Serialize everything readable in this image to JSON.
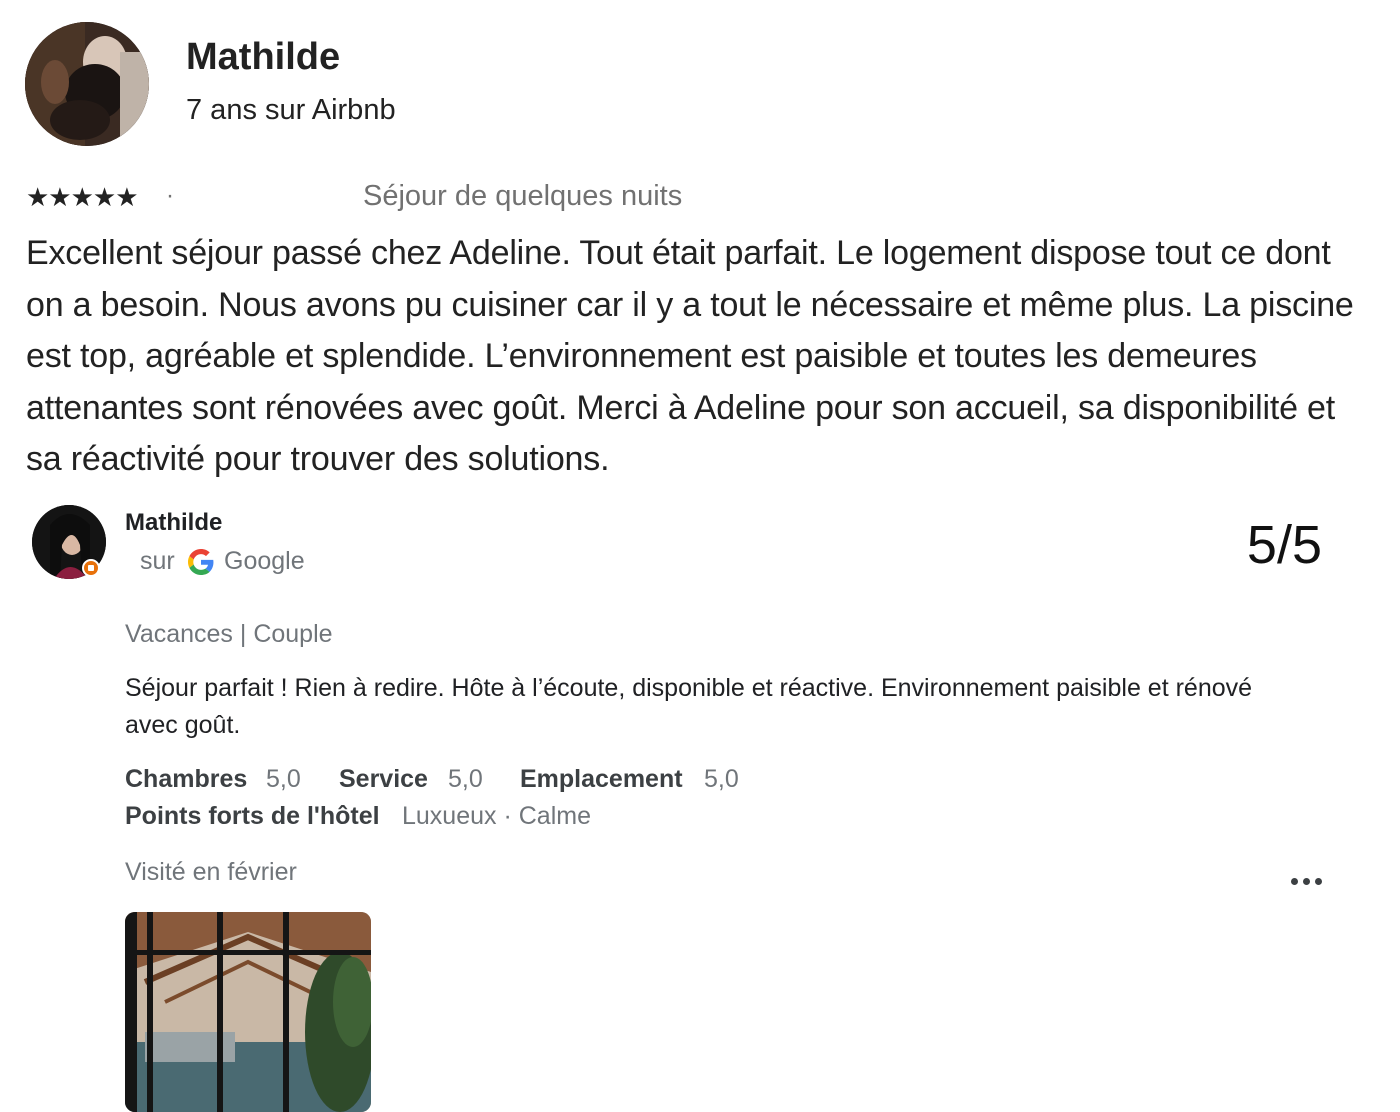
{
  "airbnb_review": {
    "reviewer_name": "Mathilde",
    "member_since": "7 ans sur Airbnb",
    "stars": "★★★★★",
    "separator": "·",
    "stay_length": "Séjour de quelques nuits",
    "text": "Excellent séjour passé chez Adeline. Tout était parfait. Le logement dispose tout ce dont on a besoin. Nous avons pu cuisiner car il y a tout le nécessaire et même plus. La piscine est top, agréable et splendide. L’environnement est paisible et toutes les demeures attenantes sont rénovées avec goût. Merci à Adeline pour son accueil, sa disponibilité et sa réactivité pour trouver des solutions."
  },
  "google_review": {
    "reviewer_name": "Mathilde",
    "source_prefix": "sur",
    "source_name": "Google",
    "score": "5/5",
    "trip_type": "Vacances | Couple",
    "text": "Séjour parfait ! Rien à redire. Hôte à l’écoute, disponible et réactive. Environnement paisible et rénové avec goût.",
    "ratings": [
      {
        "label": "Chambres",
        "value": "5,0"
      },
      {
        "label": "Service",
        "value": "5,0"
      },
      {
        "label": "Emplacement",
        "value": "5,0"
      }
    ],
    "highlights_label": "Points forts de l'hôtel",
    "highlights_value": "Luxueux · Calme",
    "visited": "Visité en février"
  },
  "colors": {
    "text_primary": "#222222",
    "text_secondary": "#70757a",
    "badge": "#e8710a",
    "google_blue": "#4285F4",
    "google_red": "#EA4335",
    "google_yellow": "#FBBC05",
    "google_green": "#34A853"
  }
}
